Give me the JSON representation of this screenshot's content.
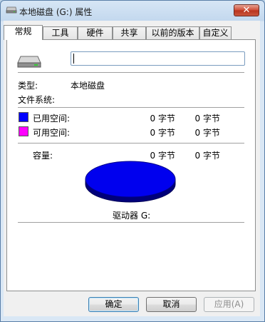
{
  "window": {
    "title": "本地磁盘 (G:) 属性",
    "close_symbol": "✕"
  },
  "tabs": [
    {
      "label": "常规",
      "active": true
    },
    {
      "label": "工具"
    },
    {
      "label": "硬件"
    },
    {
      "label": "共享"
    },
    {
      "label": "以前的版本"
    },
    {
      "label": "自定义"
    }
  ],
  "general": {
    "volume_name_value": "",
    "type_label": "类型:",
    "type_value": "本地磁盘",
    "filesystem_label": "文件系统:",
    "filesystem_value": "",
    "used_label": "已用空间:",
    "used_bytes": "0 字节",
    "used_size": "0 字节",
    "free_label": "可用空间:",
    "free_bytes": "0 字节",
    "free_size": "0 字节",
    "capacity_label": "容量:",
    "capacity_bytes": "0 字节",
    "capacity_size": "0 字节",
    "drive_label": "驱动器 G:"
  },
  "colors": {
    "used": "#0000ff",
    "free": "#ff00ff",
    "pie": "#0000ee"
  },
  "icons": {
    "title": "drive-icon",
    "drive": "hard-drive-icon"
  },
  "buttons": {
    "ok": "确定",
    "cancel": "取消",
    "apply": "应用(A)"
  }
}
